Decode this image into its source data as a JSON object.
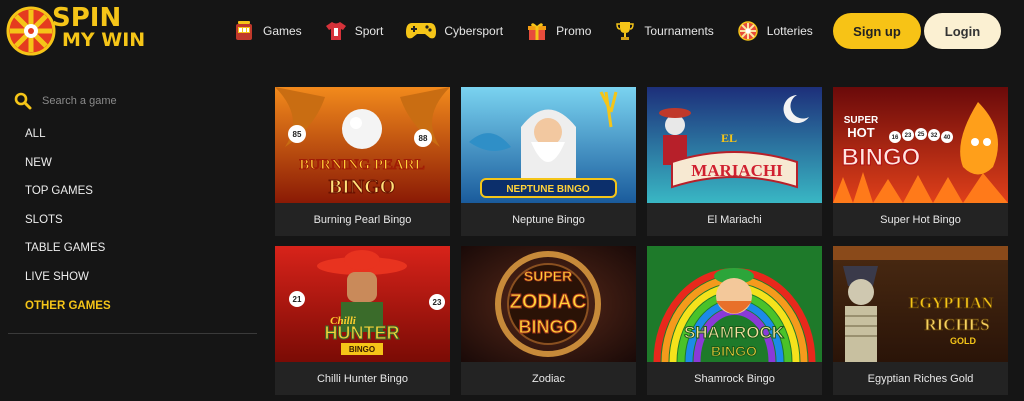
{
  "brand": {
    "line1": "SPIN",
    "line2": "MY WIN"
  },
  "nav": [
    {
      "label": "Games",
      "icon": "slot-machine-icon"
    },
    {
      "label": "Sport",
      "icon": "jersey-icon"
    },
    {
      "label": "Cybersport",
      "icon": "gamepad-icon"
    },
    {
      "label": "Promo",
      "icon": "gift-icon"
    },
    {
      "label": "Tournaments",
      "icon": "trophy-icon"
    },
    {
      "label": "Lotteries",
      "icon": "lottery-wheel-icon"
    }
  ],
  "auth": {
    "signup": "Sign up",
    "login": "Login"
  },
  "sidebar": {
    "search_placeholder": "Search a game",
    "items": [
      {
        "label": "ALL"
      },
      {
        "label": "NEW"
      },
      {
        "label": "TOP GAMES"
      },
      {
        "label": "SLOTS"
      },
      {
        "label": "TABLE GAMES"
      },
      {
        "label": "LIVE SHOW"
      },
      {
        "label": "OTHER GAMES",
        "active": true
      }
    ]
  },
  "games": [
    {
      "title": "Burning Pearl Bingo",
      "art_line1": "BURNING PEARL",
      "art_line2": "BINGO",
      "ball_a": "85",
      "ball_b": "88"
    },
    {
      "title": "Neptune Bingo",
      "art_line1": "NEPTUNE BINGO"
    },
    {
      "title": "El Mariachi",
      "art_line1": "EL",
      "art_line2": "MARIACHI"
    },
    {
      "title": "Super Hot Bingo",
      "art_line1": "SUPER",
      "art_line2": "HOT",
      "art_line3": "BINGO",
      "balls": [
        "16",
        "23",
        "25",
        "32",
        "40"
      ]
    },
    {
      "title": "Chilli Hunter Bingo",
      "art_line1": "Chilli",
      "art_line2": "HUNTER",
      "art_line3": "BINGO",
      "ball_a": "21",
      "ball_b": "23"
    },
    {
      "title": "Zodiac",
      "art_line1": "SUPER",
      "art_line2": "ZODIAC",
      "art_line3": "BINGO"
    },
    {
      "title": "Shamrock Bingo",
      "art_line1": "SHAMROCK",
      "art_line2": "BINGO"
    },
    {
      "title": "Egyptian Riches Gold",
      "art_line1": "EGYPTIAN",
      "art_line2": "RICHES",
      "art_line3": "GOLD"
    }
  ],
  "colors": {
    "accent": "#f7c316",
    "login_bg": "#fbf0d2",
    "background": "#151515",
    "card_bg": "#232323"
  }
}
